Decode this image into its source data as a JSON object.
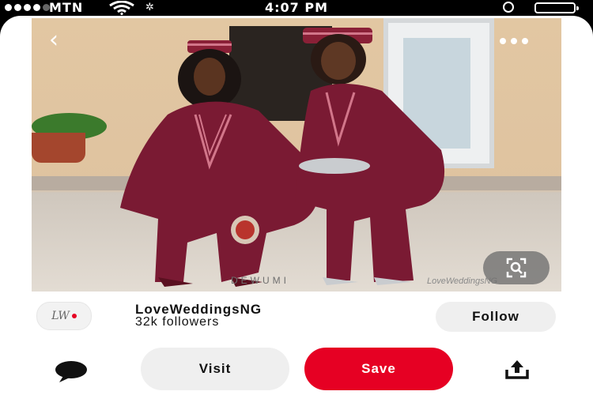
{
  "status_bar": {
    "carrier": "MTN",
    "time": "4:07 PM",
    "icons": [
      "signal-dots-icon",
      "wifi-icon",
      "brightness-icon",
      "rotation-lock-icon",
      "battery-icon"
    ]
  },
  "pin": {
    "photo_watermark": "DEWUMI",
    "photo_watermark_secondary": "LoveWeddingsNG",
    "icons": [
      "back-arrow-icon",
      "more-options-icon",
      "visual-search-icon"
    ]
  },
  "profile": {
    "avatar_text": "LW",
    "name": "LoveWeddingsNG",
    "followers": "32k followers",
    "follow_label": "Follow"
  },
  "actions": {
    "visit_label": "Visit",
    "save_label": "Save",
    "icons": [
      "comment-icon",
      "share-icon"
    ]
  },
  "colors": {
    "accent_red": "#e60023",
    "button_gray": "#efefef",
    "outfit_burgundy": "#7a1a33"
  }
}
